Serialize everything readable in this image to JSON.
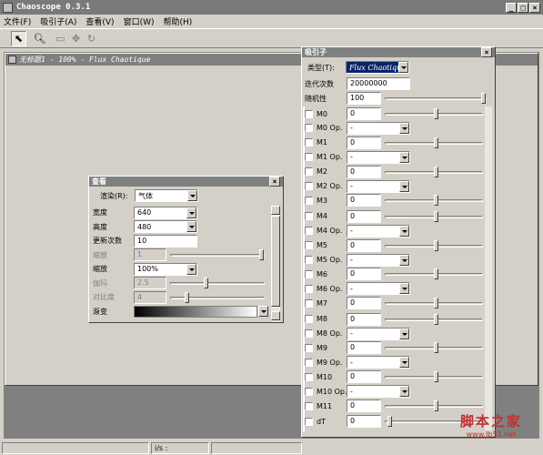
{
  "app": {
    "title": "Chaoscope 0.3.1"
  },
  "menu": [
    "文件(F)",
    "吸引子(A)",
    "查看(V)",
    "窗口(W)",
    "帮助(H)"
  ],
  "toolbar": {
    "icons": [
      "arrow-cursor-icon",
      "zoom-icon",
      "fit-icon",
      "move-icon",
      "rotate-icon"
    ]
  },
  "doc": {
    "title": "无标题1 - 100% - Flux Chaotique"
  },
  "view": {
    "title": "查看",
    "render_label": "渲染(R):",
    "render_value": "气体",
    "rows": [
      {
        "label": "宽度",
        "value": "640",
        "type": "combo",
        "enabled": true
      },
      {
        "label": "高度",
        "value": "480",
        "type": "combo",
        "enabled": true
      },
      {
        "label": "更新次数",
        "value": "10",
        "type": "field",
        "enabled": true
      },
      {
        "label": "缩放",
        "value": "1",
        "type": "slider",
        "enabled": false
      },
      {
        "label": "缩放",
        "value": "100%",
        "type": "combo",
        "enabled": true
      },
      {
        "label": "伽玛",
        "value": "2.5",
        "type": "slider",
        "enabled": false
      },
      {
        "label": "对比度",
        "value": "4",
        "type": "slider",
        "enabled": false
      },
      {
        "label": "渐变",
        "value": "",
        "type": "gradient",
        "enabled": true
      }
    ]
  },
  "attractor": {
    "title": "吸引子",
    "type_label": "类型(T):",
    "type_value": "Flux Chaotique",
    "iterations_label": "迭代次数",
    "iterations_value": "20000000",
    "random_label": "随机性",
    "random_value": "100",
    "params": [
      {
        "label": "M0",
        "value": "0",
        "kind": "s"
      },
      {
        "label": "M0 Op.",
        "value": "-",
        "kind": "c"
      },
      {
        "label": "M1",
        "value": "0",
        "kind": "s"
      },
      {
        "label": "M1 Op.",
        "value": "-",
        "kind": "c"
      },
      {
        "label": "M2",
        "value": "0",
        "kind": "s"
      },
      {
        "label": "M2 Op.",
        "value": "-",
        "kind": "c"
      },
      {
        "label": "M3",
        "value": "0",
        "kind": "s"
      },
      {
        "label": "M4",
        "value": "0",
        "kind": "s"
      },
      {
        "label": "M4 Op.",
        "value": "-",
        "kind": "c"
      },
      {
        "label": "M5",
        "value": "0",
        "kind": "s"
      },
      {
        "label": "M5 Op.",
        "value": "-",
        "kind": "c"
      },
      {
        "label": "M6",
        "value": "0",
        "kind": "s"
      },
      {
        "label": "M6 Op.",
        "value": "-",
        "kind": "c"
      },
      {
        "label": "M7",
        "value": "0",
        "kind": "s"
      },
      {
        "label": "M8",
        "value": "0",
        "kind": "s"
      },
      {
        "label": "M8 Op.",
        "value": "-",
        "kind": "c"
      },
      {
        "label": "M9",
        "value": "0",
        "kind": "s"
      },
      {
        "label": "M9 Op.",
        "value": "-",
        "kind": "c"
      },
      {
        "label": "M10",
        "value": "0",
        "kind": "s"
      },
      {
        "label": "M10 Op.",
        "value": "-",
        "kind": "c"
      },
      {
        "label": "M11",
        "value": "0",
        "kind": "s"
      },
      {
        "label": "dT",
        "value": "0",
        "kind": "s"
      }
    ]
  },
  "status": {
    "fps": "i/s :"
  },
  "watermark": {
    "text": "脚本之家",
    "url": "www.Jb51.net"
  }
}
